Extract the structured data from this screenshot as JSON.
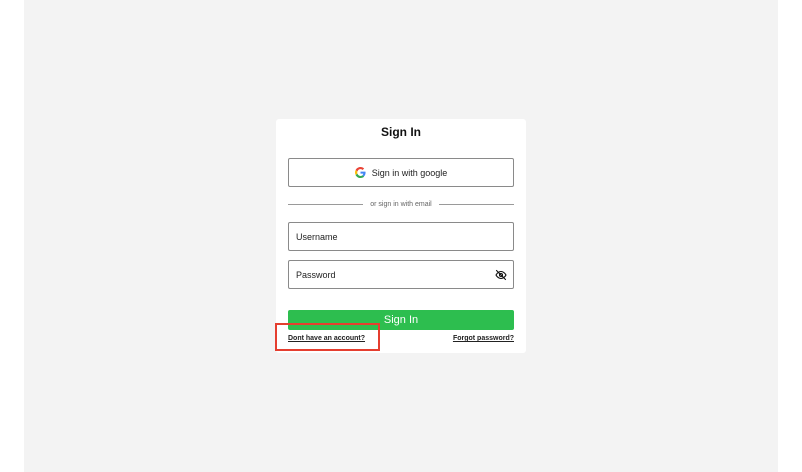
{
  "form": {
    "title": "Sign In",
    "google_button_label": "Sign in with google",
    "divider_text": "or sign in with email",
    "username_placeholder": "Username",
    "password_placeholder": "Password",
    "submit_label": "Sign In",
    "signup_link": "Dont have an account?",
    "forgot_link": "Forgot password?"
  },
  "icons": {
    "google": "google-icon",
    "password_visibility": "eye-off-icon"
  },
  "colors": {
    "accent": "#2dbe4f",
    "highlight": "#e53e2f",
    "backdrop": "#f3f3f3"
  }
}
